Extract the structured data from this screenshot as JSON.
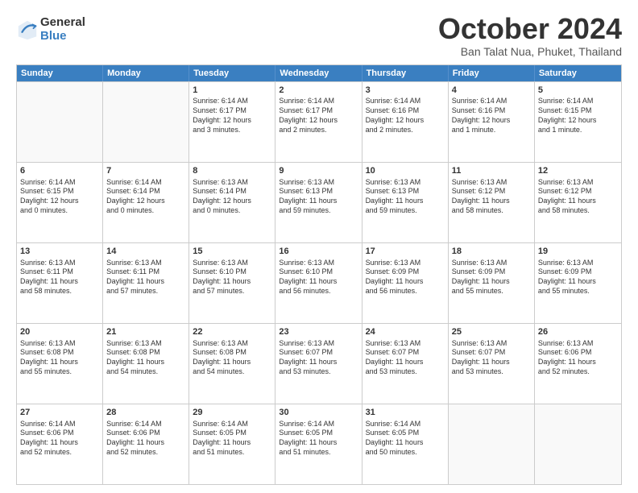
{
  "logo": {
    "general": "General",
    "blue": "Blue"
  },
  "title": "October 2024",
  "subtitle": "Ban Talat Nua, Phuket, Thailand",
  "header": {
    "days": [
      "Sunday",
      "Monday",
      "Tuesday",
      "Wednesday",
      "Thursday",
      "Friday",
      "Saturday"
    ]
  },
  "weeks": [
    [
      {
        "day": "",
        "empty": true,
        "lines": []
      },
      {
        "day": "",
        "empty": true,
        "lines": []
      },
      {
        "day": "1",
        "empty": false,
        "lines": [
          "Sunrise: 6:14 AM",
          "Sunset: 6:17 PM",
          "Daylight: 12 hours",
          "and 3 minutes."
        ]
      },
      {
        "day": "2",
        "empty": false,
        "lines": [
          "Sunrise: 6:14 AM",
          "Sunset: 6:17 PM",
          "Daylight: 12 hours",
          "and 2 minutes."
        ]
      },
      {
        "day": "3",
        "empty": false,
        "lines": [
          "Sunrise: 6:14 AM",
          "Sunset: 6:16 PM",
          "Daylight: 12 hours",
          "and 2 minutes."
        ]
      },
      {
        "day": "4",
        "empty": false,
        "lines": [
          "Sunrise: 6:14 AM",
          "Sunset: 6:16 PM",
          "Daylight: 12 hours",
          "and 1 minute."
        ]
      },
      {
        "day": "5",
        "empty": false,
        "lines": [
          "Sunrise: 6:14 AM",
          "Sunset: 6:15 PM",
          "Daylight: 12 hours",
          "and 1 minute."
        ]
      }
    ],
    [
      {
        "day": "6",
        "empty": false,
        "lines": [
          "Sunrise: 6:14 AM",
          "Sunset: 6:15 PM",
          "Daylight: 12 hours",
          "and 0 minutes."
        ]
      },
      {
        "day": "7",
        "empty": false,
        "lines": [
          "Sunrise: 6:14 AM",
          "Sunset: 6:14 PM",
          "Daylight: 12 hours",
          "and 0 minutes."
        ]
      },
      {
        "day": "8",
        "empty": false,
        "lines": [
          "Sunrise: 6:13 AM",
          "Sunset: 6:14 PM",
          "Daylight: 12 hours",
          "and 0 minutes."
        ]
      },
      {
        "day": "9",
        "empty": false,
        "lines": [
          "Sunrise: 6:13 AM",
          "Sunset: 6:13 PM",
          "Daylight: 11 hours",
          "and 59 minutes."
        ]
      },
      {
        "day": "10",
        "empty": false,
        "lines": [
          "Sunrise: 6:13 AM",
          "Sunset: 6:13 PM",
          "Daylight: 11 hours",
          "and 59 minutes."
        ]
      },
      {
        "day": "11",
        "empty": false,
        "lines": [
          "Sunrise: 6:13 AM",
          "Sunset: 6:12 PM",
          "Daylight: 11 hours",
          "and 58 minutes."
        ]
      },
      {
        "day": "12",
        "empty": false,
        "lines": [
          "Sunrise: 6:13 AM",
          "Sunset: 6:12 PM",
          "Daylight: 11 hours",
          "and 58 minutes."
        ]
      }
    ],
    [
      {
        "day": "13",
        "empty": false,
        "lines": [
          "Sunrise: 6:13 AM",
          "Sunset: 6:11 PM",
          "Daylight: 11 hours",
          "and 58 minutes."
        ]
      },
      {
        "day": "14",
        "empty": false,
        "lines": [
          "Sunrise: 6:13 AM",
          "Sunset: 6:11 PM",
          "Daylight: 11 hours",
          "and 57 minutes."
        ]
      },
      {
        "day": "15",
        "empty": false,
        "lines": [
          "Sunrise: 6:13 AM",
          "Sunset: 6:10 PM",
          "Daylight: 11 hours",
          "and 57 minutes."
        ]
      },
      {
        "day": "16",
        "empty": false,
        "lines": [
          "Sunrise: 6:13 AM",
          "Sunset: 6:10 PM",
          "Daylight: 11 hours",
          "and 56 minutes."
        ]
      },
      {
        "day": "17",
        "empty": false,
        "lines": [
          "Sunrise: 6:13 AM",
          "Sunset: 6:09 PM",
          "Daylight: 11 hours",
          "and 56 minutes."
        ]
      },
      {
        "day": "18",
        "empty": false,
        "lines": [
          "Sunrise: 6:13 AM",
          "Sunset: 6:09 PM",
          "Daylight: 11 hours",
          "and 55 minutes."
        ]
      },
      {
        "day": "19",
        "empty": false,
        "lines": [
          "Sunrise: 6:13 AM",
          "Sunset: 6:09 PM",
          "Daylight: 11 hours",
          "and 55 minutes."
        ]
      }
    ],
    [
      {
        "day": "20",
        "empty": false,
        "lines": [
          "Sunrise: 6:13 AM",
          "Sunset: 6:08 PM",
          "Daylight: 11 hours",
          "and 55 minutes."
        ]
      },
      {
        "day": "21",
        "empty": false,
        "lines": [
          "Sunrise: 6:13 AM",
          "Sunset: 6:08 PM",
          "Daylight: 11 hours",
          "and 54 minutes."
        ]
      },
      {
        "day": "22",
        "empty": false,
        "lines": [
          "Sunrise: 6:13 AM",
          "Sunset: 6:08 PM",
          "Daylight: 11 hours",
          "and 54 minutes."
        ]
      },
      {
        "day": "23",
        "empty": false,
        "lines": [
          "Sunrise: 6:13 AM",
          "Sunset: 6:07 PM",
          "Daylight: 11 hours",
          "and 53 minutes."
        ]
      },
      {
        "day": "24",
        "empty": false,
        "lines": [
          "Sunrise: 6:13 AM",
          "Sunset: 6:07 PM",
          "Daylight: 11 hours",
          "and 53 minutes."
        ]
      },
      {
        "day": "25",
        "empty": false,
        "lines": [
          "Sunrise: 6:13 AM",
          "Sunset: 6:07 PM",
          "Daylight: 11 hours",
          "and 53 minutes."
        ]
      },
      {
        "day": "26",
        "empty": false,
        "lines": [
          "Sunrise: 6:13 AM",
          "Sunset: 6:06 PM",
          "Daylight: 11 hours",
          "and 52 minutes."
        ]
      }
    ],
    [
      {
        "day": "27",
        "empty": false,
        "lines": [
          "Sunrise: 6:14 AM",
          "Sunset: 6:06 PM",
          "Daylight: 11 hours",
          "and 52 minutes."
        ]
      },
      {
        "day": "28",
        "empty": false,
        "lines": [
          "Sunrise: 6:14 AM",
          "Sunset: 6:06 PM",
          "Daylight: 11 hours",
          "and 52 minutes."
        ]
      },
      {
        "day": "29",
        "empty": false,
        "lines": [
          "Sunrise: 6:14 AM",
          "Sunset: 6:05 PM",
          "Daylight: 11 hours",
          "and 51 minutes."
        ]
      },
      {
        "day": "30",
        "empty": false,
        "lines": [
          "Sunrise: 6:14 AM",
          "Sunset: 6:05 PM",
          "Daylight: 11 hours",
          "and 51 minutes."
        ]
      },
      {
        "day": "31",
        "empty": false,
        "lines": [
          "Sunrise: 6:14 AM",
          "Sunset: 6:05 PM",
          "Daylight: 11 hours",
          "and 50 minutes."
        ]
      },
      {
        "day": "",
        "empty": true,
        "lines": []
      },
      {
        "day": "",
        "empty": true,
        "lines": []
      }
    ]
  ]
}
